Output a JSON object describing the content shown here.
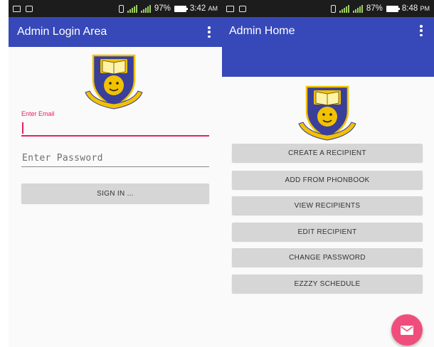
{
  "left_screen": {
    "status_bar": {
      "battery": "97%",
      "time": "3:42",
      "ampm": "AM"
    },
    "app_bar": {
      "title": "Admin Login Area",
      "menu_icon": "overflow-menu-icon"
    },
    "logo_icon": "university-crest-icon",
    "email": {
      "label": "Enter Email",
      "value": ""
    },
    "password": {
      "placeholder": "Enter Password",
      "value": ""
    },
    "sign_in_label": "SIGN IN ..."
  },
  "right_screen": {
    "status_bar": {
      "battery": "87%",
      "time": "8:48",
      "ampm": "PM"
    },
    "app_bar": {
      "title": "Admin Home",
      "menu_icon": "overflow-menu-icon"
    },
    "logo_icon": "university-crest-icon",
    "menu": {
      "create_recipient": "CREATE A RECIPIENT",
      "add_from_phonebook": "ADD FROM PHONBOOK",
      "view_recipients": "VIEW RECIPIENTS",
      "edit_recipient": "EDIT RECIPIENT",
      "change_password": "CHANGE PASSWORD",
      "ezzzy_schedule": "EZZZY SCHEDULE"
    },
    "fab_icon": "mail-icon"
  },
  "colors": {
    "app_bar": "#3748b8",
    "accent": "#e91e63",
    "fab": "#ef4e7c",
    "status_bar": "#1c1c1c",
    "button": "#d6d6d6"
  }
}
